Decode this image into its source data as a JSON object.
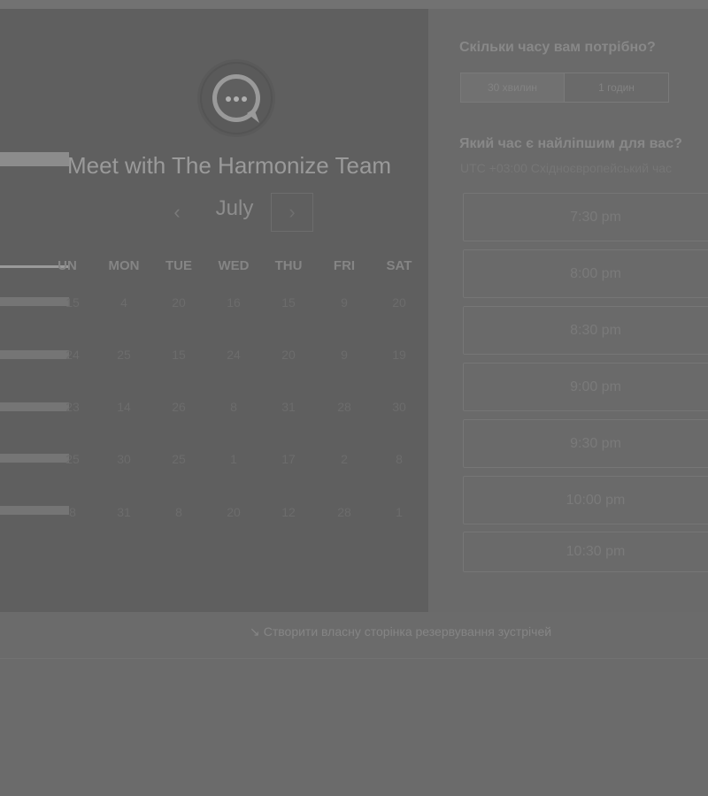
{
  "booking": {
    "title": "Meet with The Harmonize Team",
    "month": "July",
    "prev_icon": "chevron-left-icon",
    "next_icon": "chevron-right-icon",
    "weekdays": [
      "UN",
      "MON",
      "TUE",
      "WED",
      "THU",
      "FRI",
      "SAT"
    ],
    "weeks": [
      [
        "15",
        "4",
        "20",
        "16",
        "15",
        "9",
        "20"
      ],
      [
        "24",
        "25",
        "15",
        "24",
        "20",
        "9",
        "19"
      ],
      [
        "23",
        "14",
        "26",
        "8",
        "31",
        "28",
        "30"
      ],
      [
        "25",
        "30",
        "25",
        "1",
        "17",
        "2",
        "8"
      ],
      [
        "8",
        "31",
        "8",
        "20",
        "12",
        "28",
        "1"
      ]
    ]
  },
  "duration": {
    "heading": "Скільки часу вам потрібно?",
    "options": [
      "30 хвилин",
      "1 годин"
    ],
    "selected": "30 хвилин"
  },
  "times": {
    "heading": "Який час є найліпшим для вас?",
    "timezone": "UTC +03:00 Східноєвропейський час",
    "slots": [
      "7:30 pm",
      "8:00 pm",
      "8:30 pm",
      "9:00 pm",
      "9:30 pm",
      "10:00 pm",
      "10:30 pm"
    ]
  },
  "footer": {
    "link": "Створити власну сторінка резервування зустрічей",
    "icon": "cursor-arrow-icon"
  },
  "colors": {
    "overlay_background": "#6b6b6b",
    "left_panel": "#5f5f5f",
    "right_panel": "#6a6a6a"
  }
}
